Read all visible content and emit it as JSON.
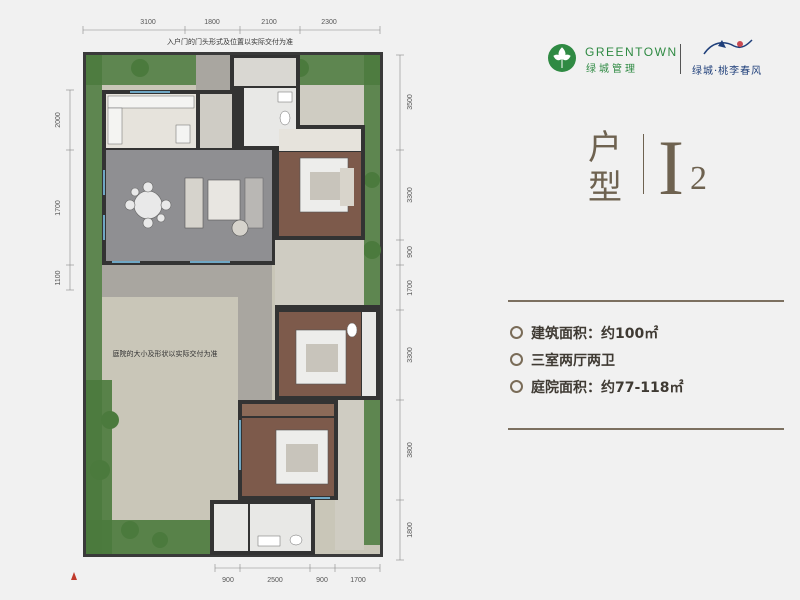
{
  "plan": {
    "top_note": "入户门的门头形式及位置以实际交付为准",
    "yard_note": "庭院的大小及形状以实际交付为准",
    "dims_top": [
      "3100",
      "1800",
      "2100",
      "2300"
    ],
    "dims_bottom": [
      "900",
      "2500",
      "900",
      "1700"
    ],
    "dims_left": [
      "2000",
      "1700",
      "1100"
    ],
    "dims_right": [
      "3500",
      "3300",
      "900",
      "1700",
      "3300",
      "3800",
      "1800"
    ]
  },
  "brand": {
    "name_en": "GREENTOWN",
    "name_cn": "绿城管理",
    "project": "绿城·桃李春风"
  },
  "unit": {
    "label": "户型",
    "code_letter": "I",
    "code_number": "2"
  },
  "specs": [
    "建筑面积：约100㎡",
    "三室两厅两卫",
    "庭院面积：约77-118㎡"
  ],
  "colors": {
    "accent": "#6e6250",
    "brand_green": "#2f8a43"
  }
}
